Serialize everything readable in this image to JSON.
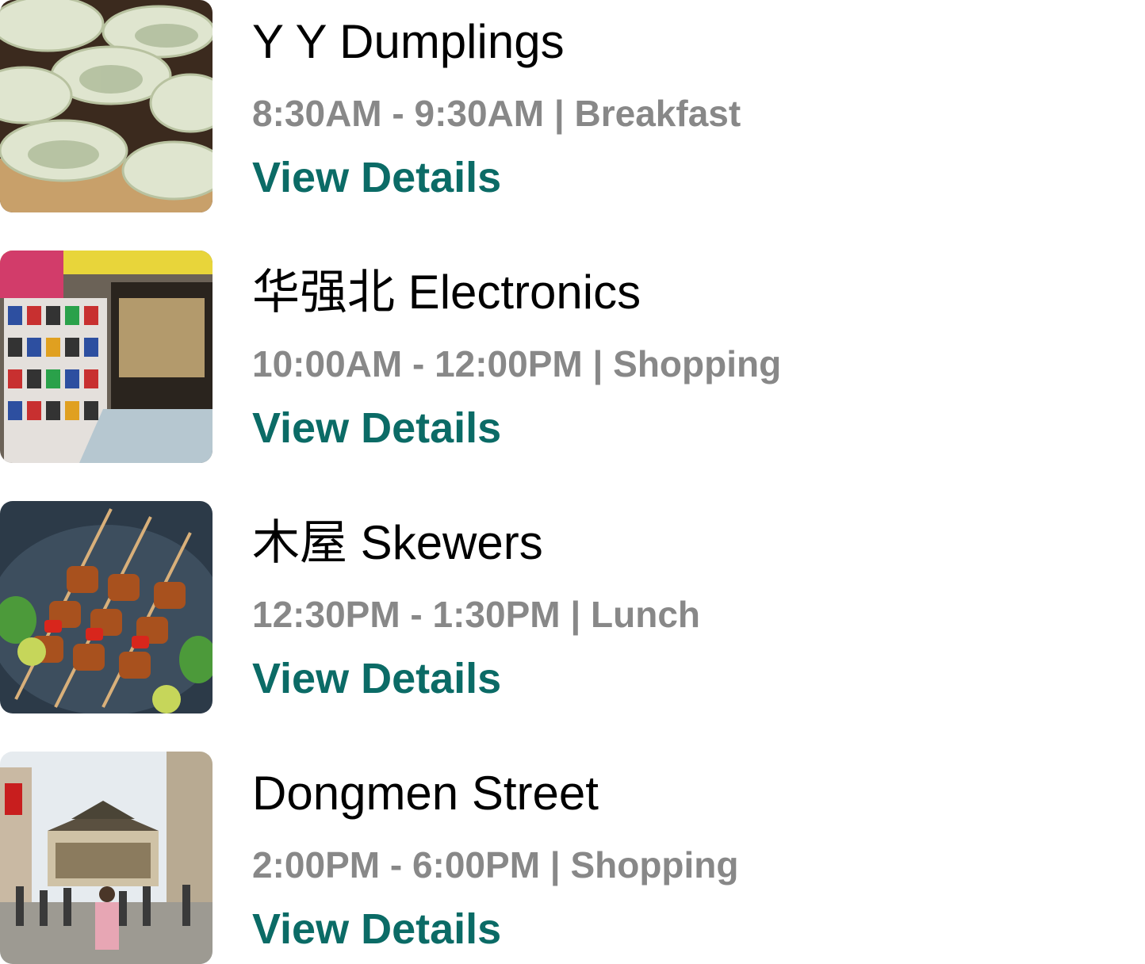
{
  "accent_color": "#0b6b66",
  "items": [
    {
      "title": "Y Y Dumplings",
      "meta": "8:30AM - 9:30AM | Breakfast",
      "link_label": "View Details",
      "image": "dumplings-photo"
    },
    {
      "title": "华强北 Electronics",
      "meta": "10:00AM - 12:00PM | Shopping",
      "link_label": "View Details",
      "image": "electronics-market-photo"
    },
    {
      "title": "木屋 Skewers",
      "meta": "12:30PM - 1:30PM | Lunch",
      "link_label": "View Details",
      "image": "skewers-photo"
    },
    {
      "title": "Dongmen Street",
      "meta": "2:00PM - 6:00PM | Shopping",
      "link_label": "View Details",
      "image": "street-scene-photo"
    }
  ]
}
